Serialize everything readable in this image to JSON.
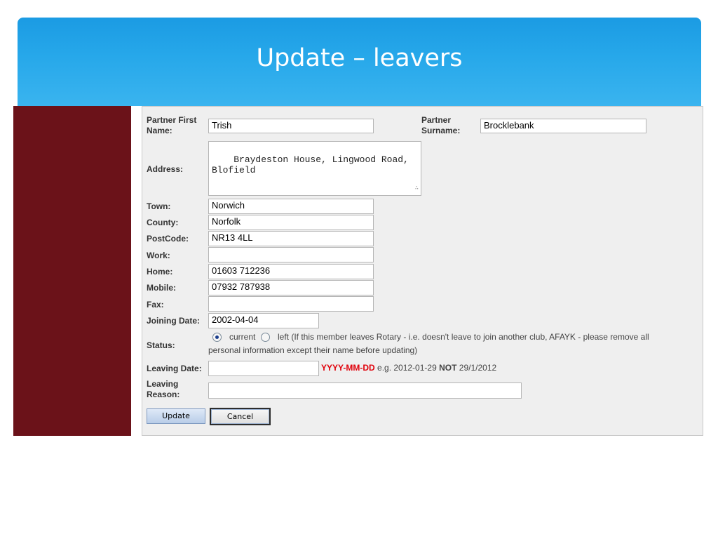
{
  "slide": {
    "title": "Update – leavers"
  },
  "form": {
    "partner_first_name_label": "Partner First Name:",
    "partner_first_name_value": "Trish",
    "partner_surname_label": "Partner Surname:",
    "partner_surname_value": "Brocklebank",
    "address_label": "Address:",
    "address_value": "Braydeston House, Lingwood Road,\nBlofield",
    "town_label": "Town:",
    "town_value": "Norwich",
    "county_label": "County:",
    "county_value": "Norfolk",
    "postcode_label": "PostCode:",
    "postcode_value": "NR13 4LL",
    "work_label": "Work:",
    "work_value": "",
    "home_label": "Home:",
    "home_value": "01603 712236",
    "mobile_label": "Mobile:",
    "mobile_value": "07932 787938",
    "fax_label": "Fax:",
    "fax_value": "",
    "joining_date_label": "Joining Date:",
    "joining_date_value": "2002-04-04",
    "status_label": "Status:",
    "status_current_label": "current",
    "status_left_label": "left (If this member leaves Rotary - i.e. doesn't leave to join another club, AFAYK - please remove all",
    "status_left_label_cont": "personal information except their name before updating)",
    "status_selected": "current",
    "leaving_date_label": "Leaving Date:",
    "leaving_date_value": "",
    "date_format_hint": "YYYY-MM-DD",
    "date_example_prefix": "e.g. 2012-01-29",
    "date_example_not": "NOT",
    "date_example_bad": "29/1/2012",
    "leaving_reason_label": "Leaving Reason:",
    "leaving_reason_value": "",
    "update_button": "Update",
    "cancel_button": "Cancel"
  },
  "colors": {
    "title_bar": "#27a8ea",
    "side_panel": "#6b1219",
    "form_background": "#efefef",
    "hint_red": "#e0000a"
  }
}
